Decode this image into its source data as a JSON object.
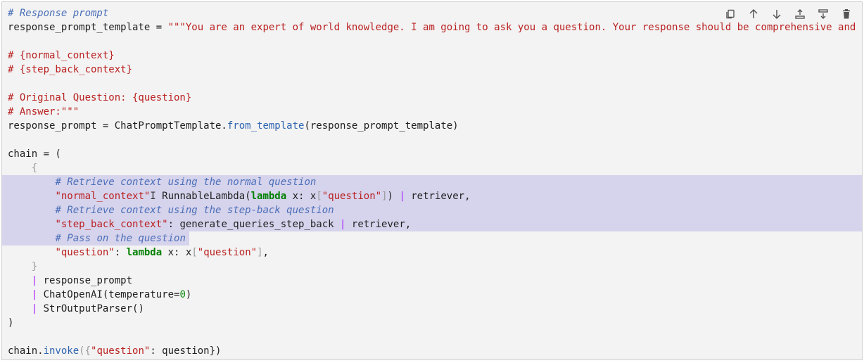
{
  "toolbar": {
    "buttons": [
      {
        "name": "duplicate-icon"
      },
      {
        "name": "move-up-icon"
      },
      {
        "name": "move-down-icon"
      },
      {
        "name": "insert-above-icon"
      },
      {
        "name": "insert-below-icon"
      },
      {
        "name": "delete-icon"
      }
    ]
  },
  "code": {
    "l1": "# Response prompt",
    "l2_var": "response_prompt_template = ",
    "l2_str": "\"\"\"You are an expert of world knowledge. I am going to ask you a question. Your response should be comprehensive and",
    "l4": "# {normal_context}",
    "l5": "# {step_back_context}",
    "l7": "# Original Question: {question}",
    "l8": "# Answer:\"\"\"",
    "l9_a": "response_prompt = ChatPromptTemplate.",
    "l9_fn": "from_template",
    "l9_b": "(response_prompt_template)",
    "l11": "chain = (",
    "l12": "{",
    "l13": "# Retrieve context using the normal question",
    "l14_key": "\"normal_context\"",
    "l14_cursor": "I",
    "l14_a": " RunnableLambda(",
    "l14_kw": "lambda",
    "l14_b": " x: x",
    "l14_br1": "[",
    "l14_str": "\"question\"",
    "l14_br2": "]",
    "l14_c": ") ",
    "l14_pipe": "|",
    "l14_d": " retriever,",
    "l15": "# Retrieve context using the step-back question",
    "l16_key": "\"step_back_context\"",
    "l16_a": ": generate_queries_step_back ",
    "l16_pipe": "|",
    "l16_b": " retriever,",
    "l17": "# Pass on the question",
    "l18_key": "\"question\"",
    "l18_a": ": ",
    "l18_kw": "lambda",
    "l18_b": " x: x",
    "l18_br1": "[",
    "l18_str": "\"question\"",
    "l18_br2": "]",
    "l18_c": ",",
    "l19": "}",
    "l20_pipe": "|",
    "l20_a": " response_prompt",
    "l21_pipe": "|",
    "l21_a": " ChatOpenAI(temperature=",
    "l21_num": "0",
    "l21_b": ")",
    "l22_pipe": "|",
    "l22_a": " StrOutputParser()",
    "l23": ")",
    "l25_a": "chain.",
    "l25_fn": "invoke",
    "l25_br1": "({",
    "l25_str": "\"question\"",
    "l25_b": ": question})"
  }
}
